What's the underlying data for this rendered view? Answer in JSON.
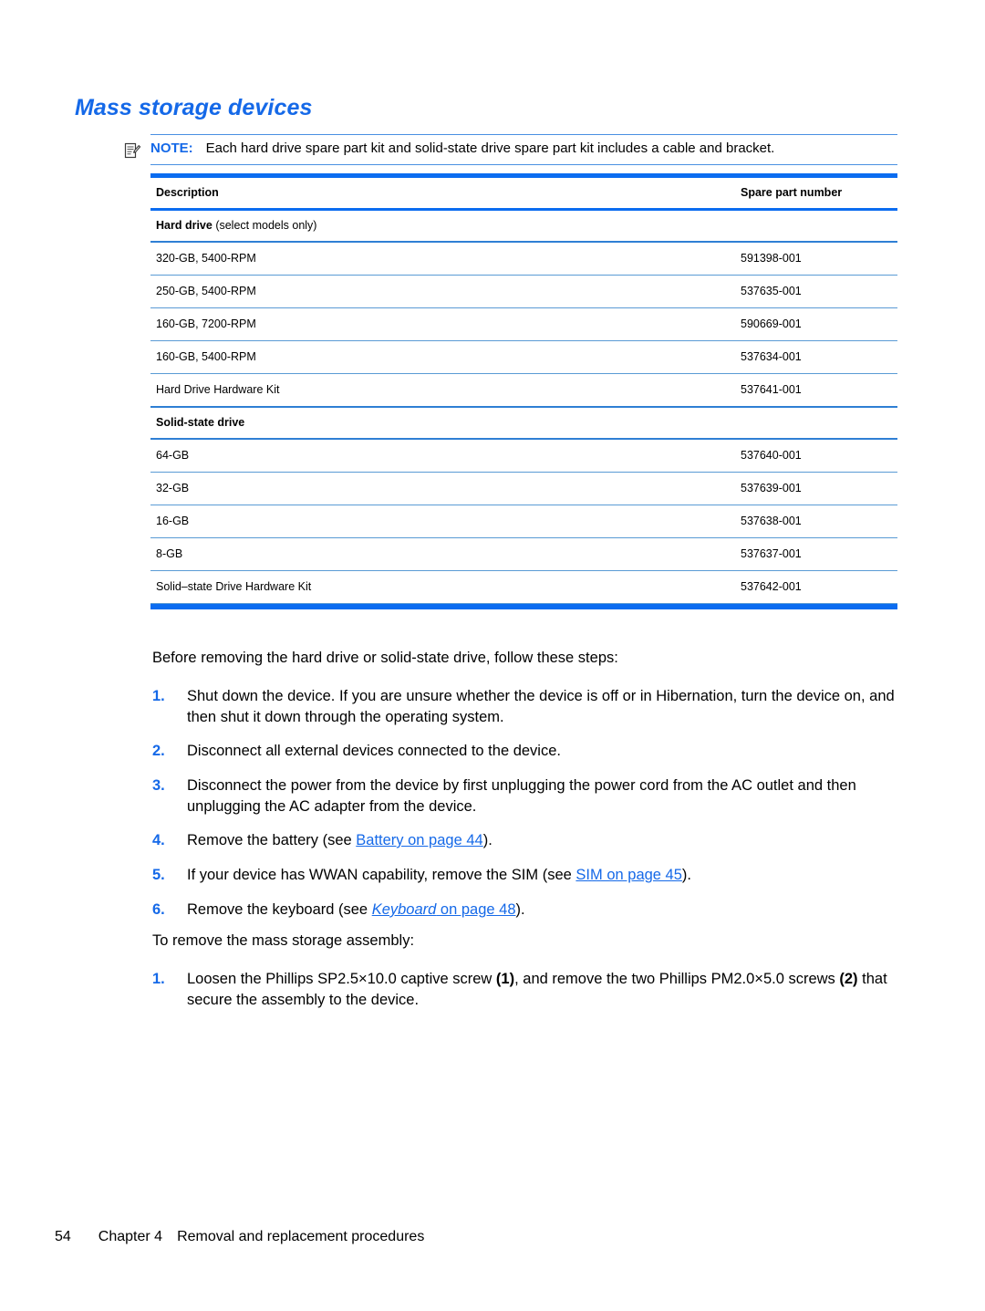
{
  "document": {
    "title": "Mass storage devices"
  },
  "note": {
    "icon": "note-pad-pencil-icon",
    "label": "NOTE:",
    "text": "Each hard drive spare part kit and solid-state drive spare part kit includes a cable and bracket."
  },
  "table": {
    "columns": [
      "Description",
      "Spare part number"
    ],
    "rows": [
      {
        "type": "group",
        "description": "Hard drive",
        "description_sub": " (select models only)",
        "part": ""
      },
      {
        "type": "data",
        "description": "320-GB, 5400-RPM",
        "part": "591398-001"
      },
      {
        "type": "data",
        "description": "250-GB, 5400-RPM",
        "part": "537635-001"
      },
      {
        "type": "data",
        "description": "160-GB, 7200-RPM",
        "part": "590669-001"
      },
      {
        "type": "data",
        "description": "160-GB, 5400-RPM",
        "part": "537634-001"
      },
      {
        "type": "data",
        "description": "Hard Drive Hardware Kit",
        "part": "537641-001"
      },
      {
        "type": "group",
        "description": "Solid-state drive",
        "description_sub": "",
        "part": ""
      },
      {
        "type": "data",
        "description": "64-GB",
        "part": "537640-001"
      },
      {
        "type": "data",
        "description": "32-GB",
        "part": "537639-001"
      },
      {
        "type": "data",
        "description": "16-GB",
        "part": "537638-001"
      },
      {
        "type": "data",
        "description": "8-GB",
        "part": "537637-001"
      },
      {
        "type": "data",
        "description": "Solid–state Drive Hardware Kit",
        "part": "537642-001"
      }
    ]
  },
  "body": {
    "lead_paragraph": "Before removing the hard drive or solid-state drive, follow these steps:",
    "steps": [
      {
        "num": "1.",
        "text": "Shut down the device. If you are unsure whether the device is off or in Hibernation, turn the device on, and then shut it down through the operating system."
      },
      {
        "num": "2.",
        "text": "Disconnect all external devices connected to the device."
      },
      {
        "num": "3.",
        "text": "Disconnect the power from the device by first unplugging the power cord from the AC outlet and then unplugging the AC adapter from the device."
      }
    ],
    "step4": {
      "num": "4.",
      "prefix": "Remove the battery (see ",
      "link": "Battery on page 44",
      "suffix": ")."
    },
    "step5": {
      "num": "5.",
      "prefix": "If your device has WWAN capability, remove the SIM (see ",
      "link": "SIM on page 45",
      "suffix": ")."
    },
    "step6": {
      "num": "6.",
      "prefix": "Remove the keyboard (see ",
      "link_italic": "Keyboard",
      "link_rest": " on page 48",
      "suffix": ")."
    },
    "mid_paragraph": "To remove the mass storage assembly:",
    "final_step": {
      "num": "1.",
      "part1": "Loosen the Phillips SP2.5×10.0 captive screw ",
      "callout1": "(1)",
      "part2": ", and remove the two Phillips PM2.0×5.0 screws ",
      "callout2": "(2)",
      "part3": " that secure the assembly to the device."
    }
  },
  "footer": {
    "page_number": "54",
    "chapter": "Chapter 4",
    "chapter_title": "Removal and replacement procedures"
  },
  "colors": {
    "accent_blue": "#1569e8",
    "bar_blue": "#0b6cf0",
    "rule_blue": "#5a9bd5",
    "group_rule_blue": "#2f7fd4"
  }
}
